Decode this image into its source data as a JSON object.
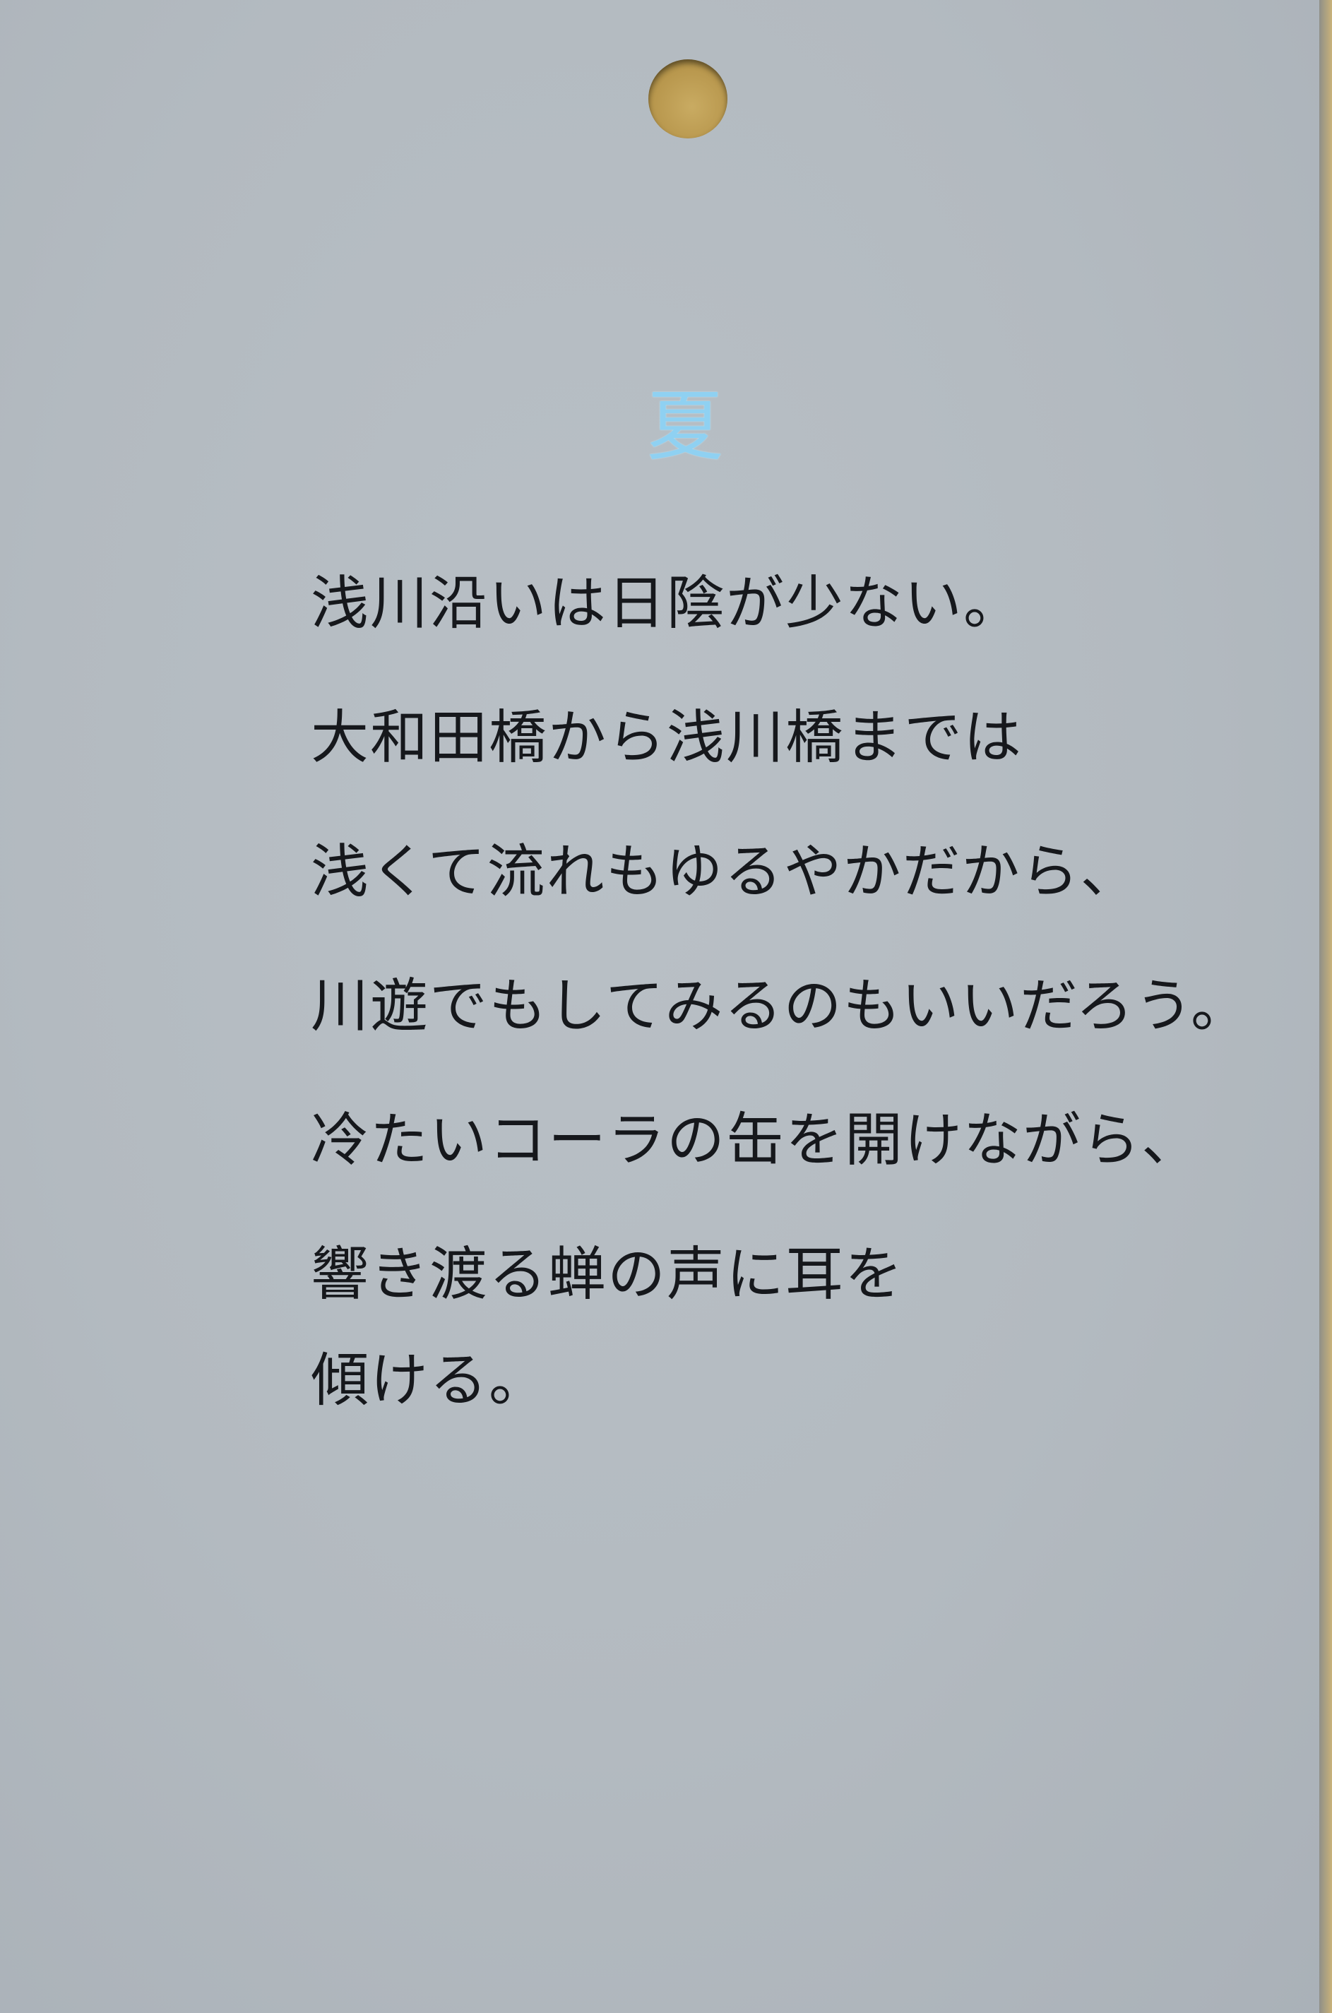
{
  "title": "夏",
  "lines": [
    "浅川沿いは日陰が少ない。",
    "大和田橋から浅川橋までは",
    "浅くて流れもゆるやかだから、",
    "川遊でもしてみるのもいいだろう。",
    "冷たいコーラの缶を開けながら、",
    "響き渡る蝉の声に耳を",
    "傾ける。"
  ]
}
